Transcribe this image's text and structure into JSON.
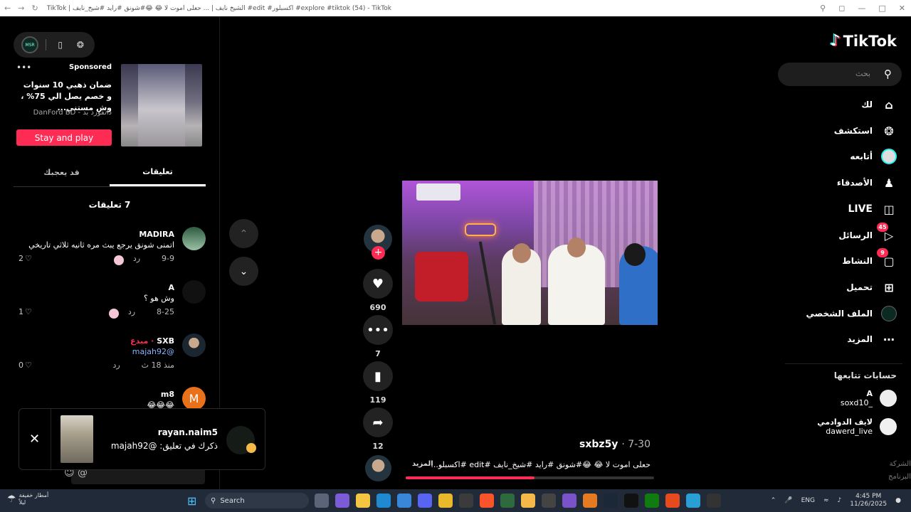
{
  "browser": {
    "title": "TikTok | الشيخ نايف | ... حعلى اموت لا 😂 😂#شونق #رايد #شيخ_نايف #edit #اكسبلور #explore #tiktok (54) - TikTok",
    "nav_icons": [
      "back-icon",
      "forward-icon",
      "refresh-icon"
    ],
    "controls": [
      "zoom-icon",
      "restore-icon",
      "minimize-icon",
      "maximize-icon",
      "close-icon"
    ]
  },
  "top_pill": {
    "avatar_text": "MSR",
    "icons": [
      "phone-icon",
      "compass-icon"
    ]
  },
  "ad": {
    "sponsored_label": "Sponsored",
    "headline": "ضمان ذهبي 10 سنوات و خصم يصل الي 75% ، وش مستني...",
    "brand": "دانفورد بد - DanFord BD",
    "cta_label": "Stay and play"
  },
  "tabs": {
    "comments": "تعليقات",
    "you_may_like": "قد يعجبك"
  },
  "comments_count_label": "7 تعليقات",
  "comments": [
    {
      "name": "MADIRA",
      "text": "اتمنى شونق يرجع يبث مره ثانيه ثلاثي تاريخي",
      "date": "9-9",
      "reply": "رد",
      "likes": "2"
    },
    {
      "name": "A",
      "text": "وش هو ؟",
      "date": "8-25",
      "reply": "رد",
      "likes": "1"
    },
    {
      "name": "SXB",
      "badge": "· مبدع",
      "text": "@majah92",
      "date": "منذ 18 ث",
      "reply": "رد",
      "likes": "0"
    },
    {
      "name": "m8",
      "text": "😂😂😂",
      "avatar_letter": "M"
    }
  ],
  "toast": {
    "close_label": "✕",
    "name": "rayan.naim5",
    "message": "ذكرك في تعليق: @majah92"
  },
  "video": {
    "author": "sxbz5y",
    "date": "7-30",
    "description": "حعلى اموت لا 😂 😂#شونق #رايد #شيخ_نايف #edit #اكسبلو...",
    "more_label": "المزيد",
    "progress": 0.52
  },
  "actions": {
    "likes": "690",
    "comments": "7",
    "saves": "119",
    "shares": "12"
  },
  "sidebar": {
    "logo_text": "TikTok",
    "search_placeholder": "بحث",
    "items": [
      {
        "label": "لك",
        "icon": "home-icon"
      },
      {
        "label": "استكشف",
        "icon": "compass-icon"
      },
      {
        "label": "أتابعه",
        "icon": "following-icon"
      },
      {
        "label": "الأصدقاء",
        "icon": "friends-icon"
      },
      {
        "label": "LIVE",
        "icon": "live-icon"
      },
      {
        "label": "الرسائل",
        "icon": "messages-icon",
        "count": "45"
      },
      {
        "label": "النشاط",
        "icon": "activity-icon",
        "count": "9"
      },
      {
        "label": "تحميل",
        "icon": "upload-icon"
      },
      {
        "label": "الملف الشخصي",
        "icon": "profile-icon"
      },
      {
        "label": "المزيد",
        "icon": "more-icon"
      }
    ],
    "following_header": "حسابات تتابعها",
    "following": [
      {
        "name": "A",
        "handle": "_soxd10"
      },
      {
        "name": "لايف الدوادمي",
        "handle": "dawerd_live"
      }
    ],
    "footer": [
      "الشركة",
      "البرنامج"
    ]
  },
  "taskbar": {
    "weather_line1": "أمطار خفيفة",
    "weather_line2": "ليلاً",
    "search_label": "Search",
    "language": "ENG",
    "time": "4:45 PM",
    "date": "11/26/2025"
  },
  "colors": {
    "accent": "#fe2c55",
    "cyan": "#25f4ee",
    "background": "#000000"
  }
}
